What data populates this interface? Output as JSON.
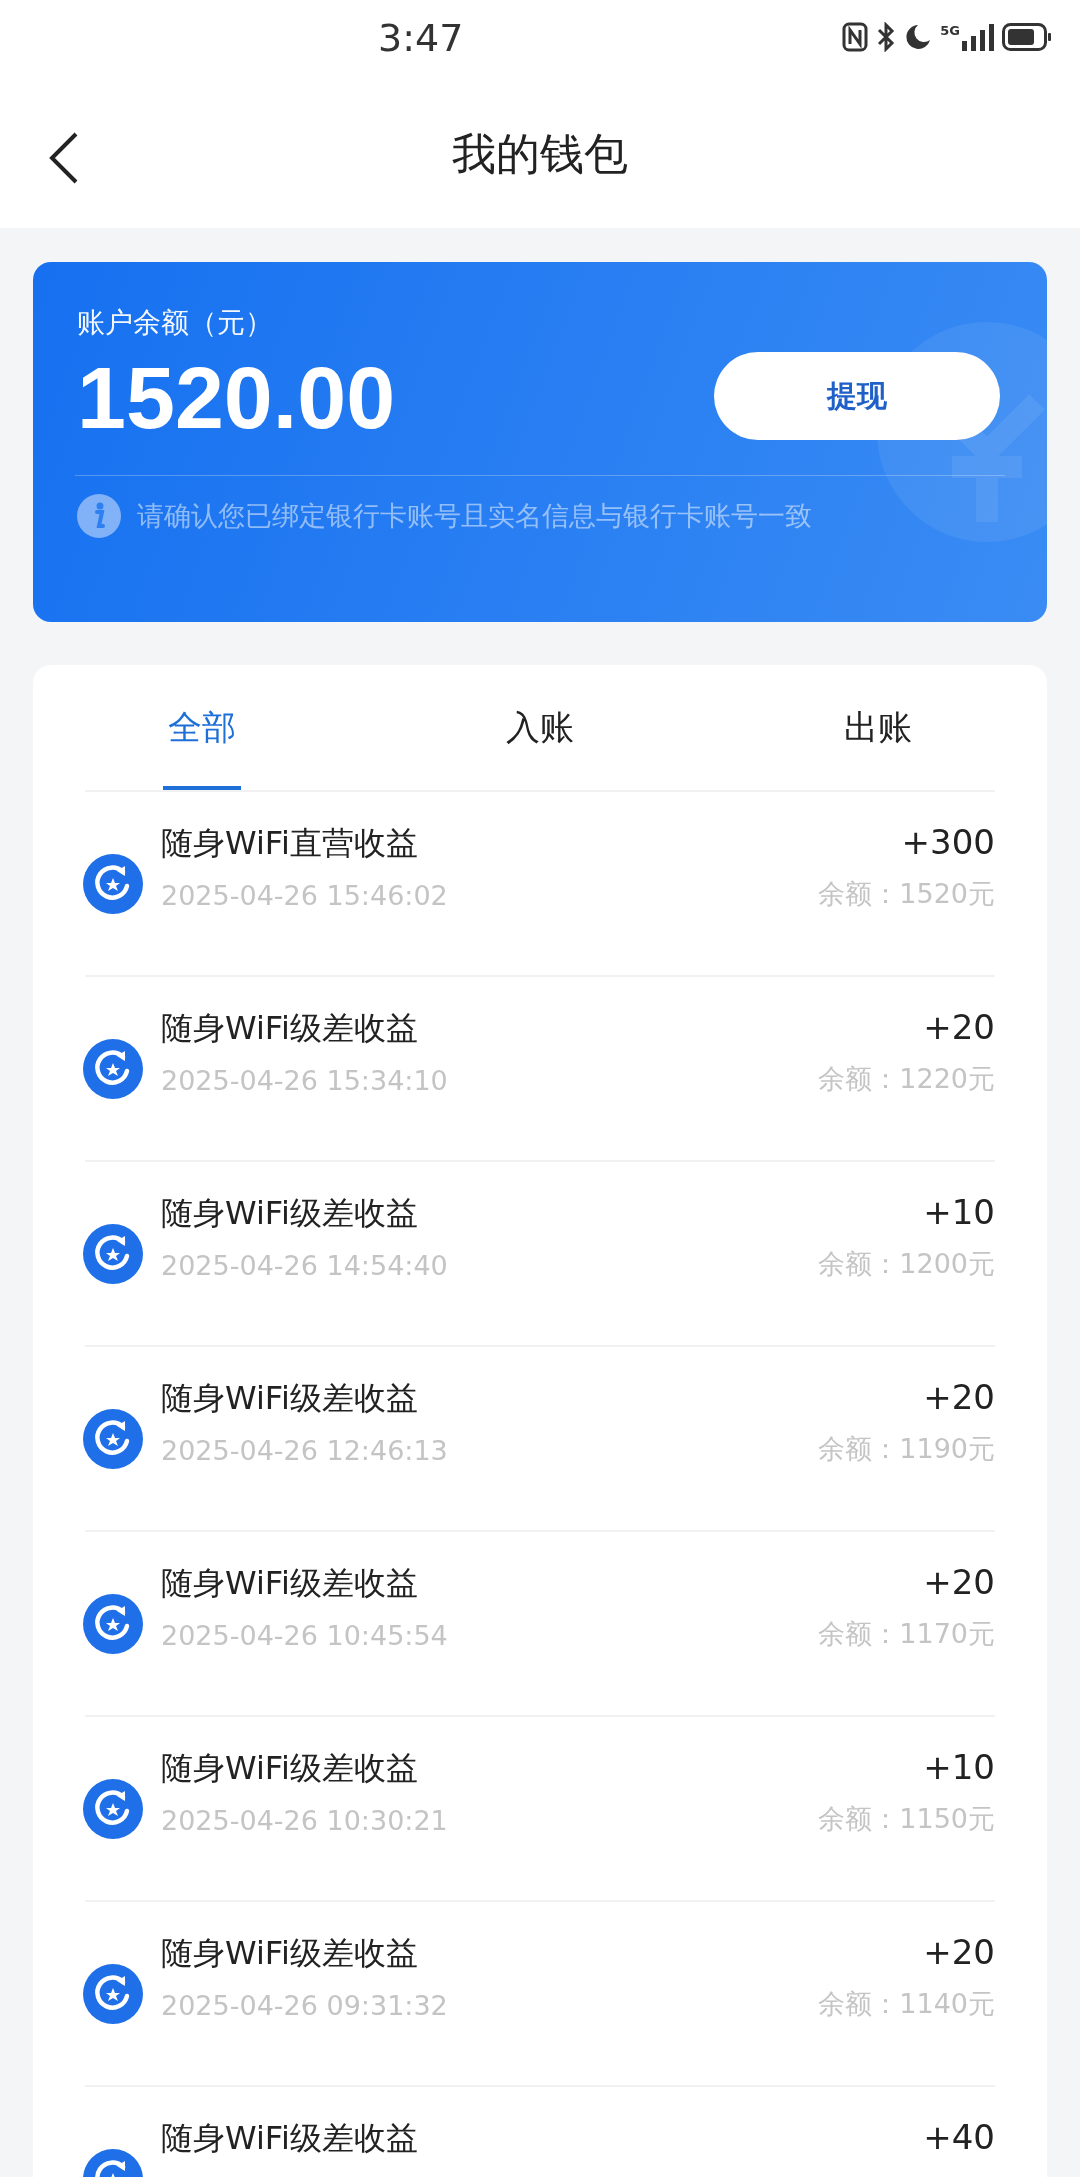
{
  "status_bar": {
    "time": "3:47",
    "network": "5G"
  },
  "header": {
    "title": "我的钱包"
  },
  "balance_card": {
    "label": "账户余额（元）",
    "amount": "1520.00",
    "button": "提现",
    "notice": "请确认您已绑定银行卡账号且实名信息与银行卡账号一致"
  },
  "tabs": [
    {
      "label": "全部",
      "selected": true
    },
    {
      "label": "入账",
      "selected": false
    },
    {
      "label": "出账",
      "selected": false
    }
  ],
  "transactions": [
    {
      "title": "随身WiFi直营收益",
      "time": "2025-04-26 15:46:02",
      "amount": "+300",
      "balance": "余额：1520元"
    },
    {
      "title": "随身WiFi级差收益",
      "time": "2025-04-26 15:34:10",
      "amount": "+20",
      "balance": "余额：1220元"
    },
    {
      "title": "随身WiFi级差收益",
      "time": "2025-04-26 14:54:40",
      "amount": "+10",
      "balance": "余额：1200元"
    },
    {
      "title": "随身WiFi级差收益",
      "time": "2025-04-26 12:46:13",
      "amount": "+20",
      "balance": "余额：1190元"
    },
    {
      "title": "随身WiFi级差收益",
      "time": "2025-04-26 10:45:54",
      "amount": "+20",
      "balance": "余额：1170元"
    },
    {
      "title": "随身WiFi级差收益",
      "time": "2025-04-26 10:30:21",
      "amount": "+10",
      "balance": "余额：1150元"
    },
    {
      "title": "随身WiFi级差收益",
      "time": "2025-04-26 09:31:32",
      "amount": "+20",
      "balance": "余额：1140元"
    },
    {
      "title": "随身WiFi级差收益",
      "amount": "+40"
    }
  ]
}
